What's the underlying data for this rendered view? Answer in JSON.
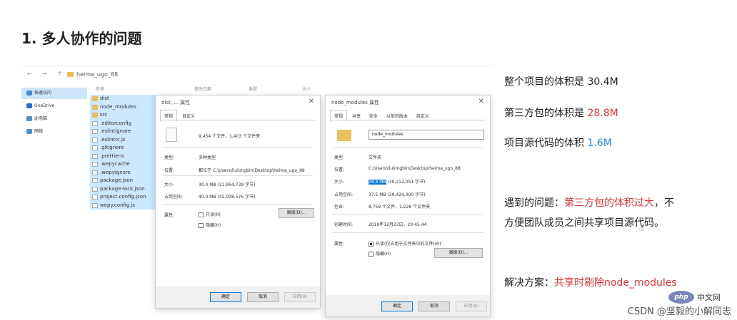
{
  "slide": {
    "title": "1. 多人协作的问题"
  },
  "explorer": {
    "path": "heima_ugo_88",
    "columns": [
      "名称",
      "修改日期",
      "类型",
      "大小"
    ],
    "sidebar": [
      {
        "label": "快速访问",
        "icon": "star-icon",
        "color": "#3b8fd8"
      },
      {
        "label": "OneDrive",
        "icon": "cloud-icon",
        "color": "#1f6fcf"
      },
      {
        "label": "此电脑",
        "icon": "computer-icon",
        "color": "#4a90c9"
      },
      {
        "label": "网络",
        "icon": "network-icon",
        "color": "#4a90c9"
      }
    ],
    "files": [
      {
        "name": "dist",
        "type": "folder"
      },
      {
        "name": "node_modules",
        "type": "folder"
      },
      {
        "name": "src",
        "type": "folder"
      },
      {
        "name": ".editorconfig",
        "type": "doc"
      },
      {
        "name": ".eslintignore",
        "type": "doc"
      },
      {
        "name": ".eslintrc.js",
        "type": "doc"
      },
      {
        "name": ".gitignore",
        "type": "doc"
      },
      {
        "name": ".prettierrc",
        "type": "doc"
      },
      {
        "name": ".wepycache",
        "type": "doc"
      },
      {
        "name": ".wepyignore",
        "type": "doc"
      },
      {
        "name": "package.json",
        "type": "doc"
      },
      {
        "name": "package-lock.json",
        "type": "doc"
      },
      {
        "name": "project.config.json",
        "type": "doc"
      },
      {
        "name": "wepy.config.js",
        "type": "doc"
      }
    ]
  },
  "dialog1": {
    "title": "dist, ... 属性",
    "tabs": [
      "常规",
      "自定义"
    ],
    "summary": "9,454 个文件，1,403 个文件夹",
    "rows": [
      {
        "label": "类型:",
        "value": "多种类型"
      },
      {
        "label": "位置:",
        "value": "都位于 C:\\Users\\liulongbin\\Desktop\\heima_ugo_88"
      },
      {
        "label": "大小:",
        "value": "30.4 MB (31,954,739 字节)"
      },
      {
        "label": "占用空间:",
        "value": "40.0 MB (42,008,576 字节)"
      }
    ],
    "attr_label": "属性:",
    "readonly": "只读(R)",
    "hidden": "隐藏(H)",
    "advanced": "高级(D)...",
    "ok": "确定",
    "cancel": "取消",
    "apply": "应用(A)"
  },
  "dialog2": {
    "title": "node_modules 属性",
    "tabs": [
      "常规",
      "共享",
      "安全",
      "以前的版本",
      "自定义"
    ],
    "name": "node_modules",
    "rows": [
      {
        "label": "类型:",
        "value": "文件夹"
      },
      {
        "label": "位置:",
        "value": "C:\\Users\\liulongbin\\Desktop\\heima_ugo_88"
      },
      {
        "label": "大小:",
        "value_hl": "28.8 MB",
        "value": " (30,212,051 字节)"
      },
      {
        "label": "占用空间:",
        "value": "37.5 MB (39,424,000 字节)"
      },
      {
        "label": "包含:",
        "value": "8,759 个文件，1,226 个文件夹"
      },
      {
        "label": "创建时间:",
        "value": "2019年12月23日，20:45:44"
      }
    ],
    "attr_label": "属性:",
    "readonly": "只读(仅应用于文件夹中的文件)(R)",
    "hidden": "隐藏(H)",
    "advanced": "高级(D)...",
    "ok": "确定",
    "cancel": "取消",
    "apply": "应用(A)"
  },
  "notes": {
    "n1_prefix": "整个项目的体积是 30.4M",
    "n2_prefix": "第三方包的体积是 ",
    "n2_value": "28.8M",
    "n3_prefix": "项目源代码的体积 ",
    "n3_value": "1.6M",
    "n4_prefix": "遇到的问题：",
    "n4_red": "第三方包的体积过大",
    "n4_suffix": "，不",
    "n5": "方便团队成员之间共享项目源代码。",
    "n6_prefix": "解决方案：",
    "n6_red": "共享时剔除node_modules"
  },
  "watermark": {
    "php_logo": "php",
    "php_text": "中文网",
    "csdn": "CSDN @坚毅的小解同志"
  },
  "colors": {
    "accent_red": "#e53333",
    "accent_blue": "#1e88e5",
    "selection": "#0078d7"
  }
}
